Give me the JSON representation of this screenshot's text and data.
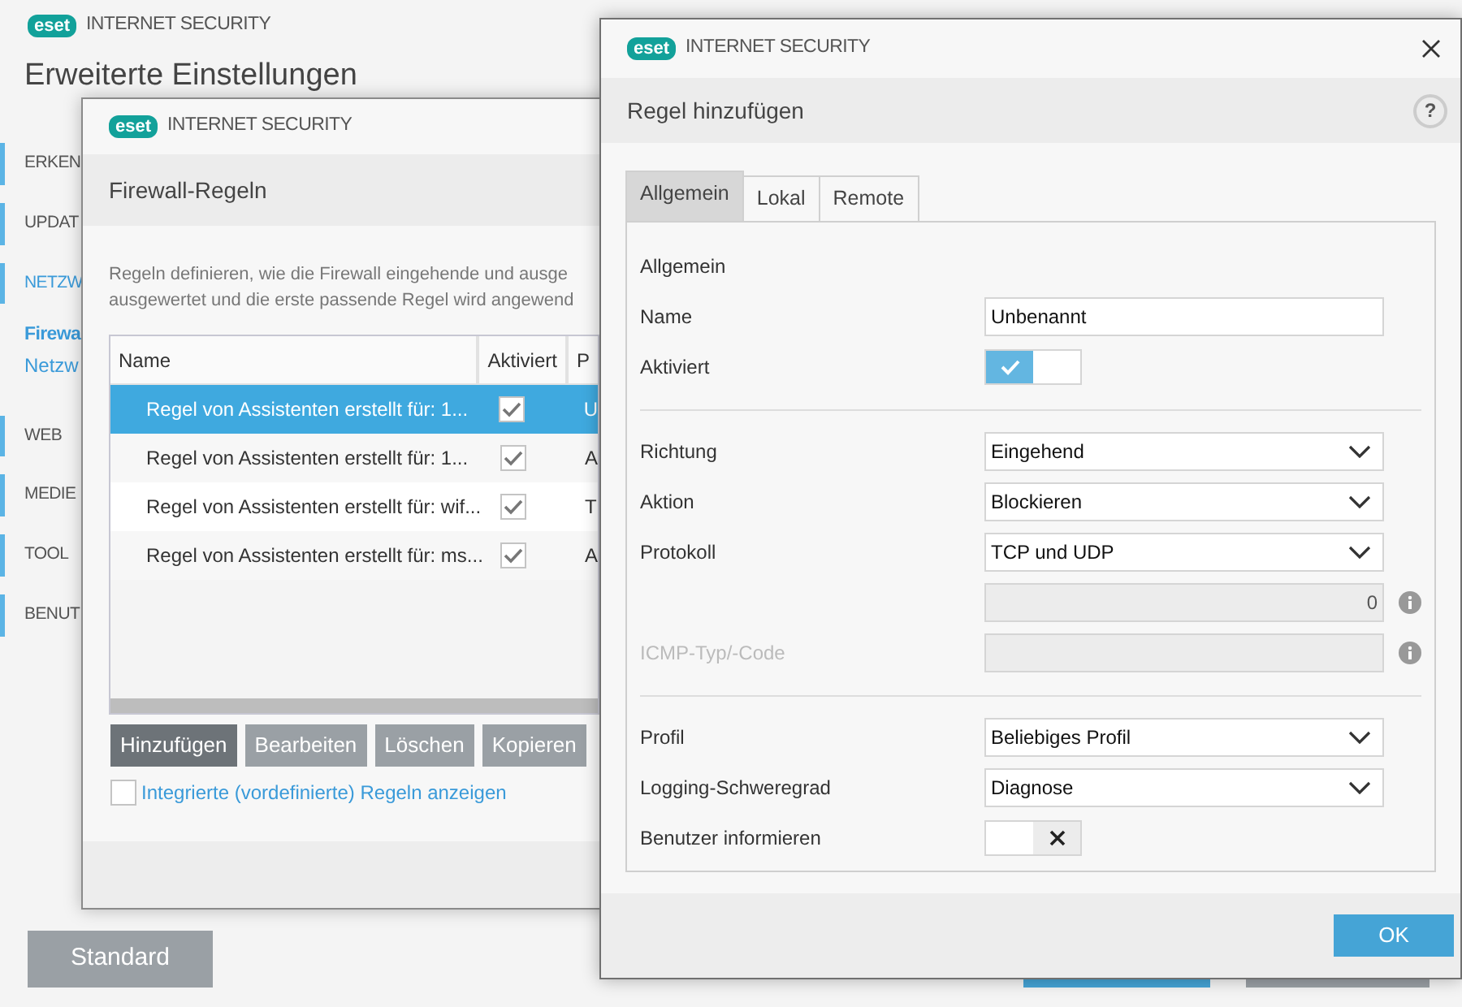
{
  "background_window": {
    "logo": "eset",
    "product": "INTERNET SECURITY",
    "title": "Erweiterte Einstellungen",
    "sidebar": [
      {
        "label": "ERKEN",
        "kind": "section",
        "expanded": false
      },
      {
        "label": "UPDAT",
        "kind": "section",
        "expanded": false
      },
      {
        "label": "NETZW",
        "kind": "section",
        "expanded": true
      },
      {
        "label": "Firewa",
        "kind": "subitem",
        "selected": true
      },
      {
        "label": "Netzw",
        "kind": "subitem",
        "selected": false
      },
      {
        "label": "WEB",
        "kind": "section",
        "expanded": false
      },
      {
        "label": "MEDIE",
        "kind": "section",
        "expanded": false
      },
      {
        "label": "TOOL",
        "kind": "section",
        "expanded": false
      },
      {
        "label": "BENUT",
        "kind": "section",
        "expanded": false
      }
    ],
    "buttons": [
      "Standard"
    ]
  },
  "firewall_dialog": {
    "logo": "eset",
    "product": "INTERNET SECURITY",
    "title": "Firewall-Regeln",
    "description": [
      "Regeln definieren, wie die Firewall eingehende und ausge",
      "ausgewertet und die erste passende Regel wird angewend"
    ],
    "table": {
      "columns": [
        "Name",
        "Aktiviert",
        "P"
      ],
      "rows": [
        {
          "name": "Regel von Assistenten erstellt für: 1...",
          "activated": true,
          "column_3": "U",
          "selected": true
        },
        {
          "name": "Regel von Assistenten erstellt für: 1...",
          "activated": true,
          "column_3": "A",
          "selected": false
        },
        {
          "name": "Regel von Assistenten erstellt für: wif...",
          "activated": true,
          "column_3": "T",
          "selected": false
        },
        {
          "name": "Regel von Assistenten erstellt für: ms...",
          "activated": true,
          "column_3": "A",
          "selected": false
        }
      ]
    },
    "buttons": [
      {
        "label": "Hinzufügen",
        "focused": true
      },
      {
        "label": "Bearbeiten",
        "focused": false
      },
      {
        "label": "Löschen",
        "focused": false
      },
      {
        "label": "Kopieren",
        "focused": false
      }
    ],
    "show_builtin": {
      "label": "Integrierte (vordefinierte) Regeln anzeigen",
      "checked": false
    }
  },
  "rule_dialog": {
    "logo": "eset",
    "product": "INTERNET SECURITY",
    "title": "Regel hinzufügen",
    "help": "?",
    "tabs": [
      {
        "label": "Allgemein",
        "selected": true
      },
      {
        "label": "Lokal",
        "selected": false
      },
      {
        "label": "Remote",
        "selected": false
      }
    ],
    "rows": [
      {
        "kind": "heading",
        "label": "Allgemein"
      },
      {
        "kind": "text",
        "label": "Name",
        "value": "Unbenannt",
        "disabled": false
      },
      {
        "kind": "toggle",
        "label": "Aktiviert",
        "on": true
      },
      {
        "kind": "divider"
      },
      {
        "kind": "select",
        "label": "Richtung",
        "value": "Eingehend"
      },
      {
        "kind": "select",
        "label": "Aktion",
        "value": "Blockieren"
      },
      {
        "kind": "select",
        "label": "Protokoll",
        "value": "TCP und UDP"
      },
      {
        "kind": "number",
        "value": "0",
        "disabled": true
      },
      {
        "kind": "text",
        "label": "ICMP-Typ/-Code",
        "disabled": true
      },
      {
        "kind": "divider"
      },
      {
        "kind": "select",
        "label": "Profil",
        "value": "Beliebiges Profil"
      },
      {
        "kind": "select",
        "label": "Logging-Schweregrad",
        "value": "Diagnose"
      },
      {
        "kind": "toggle",
        "label": "Benutzer informieren",
        "on": false
      }
    ],
    "buttons": [
      "OK"
    ]
  }
}
